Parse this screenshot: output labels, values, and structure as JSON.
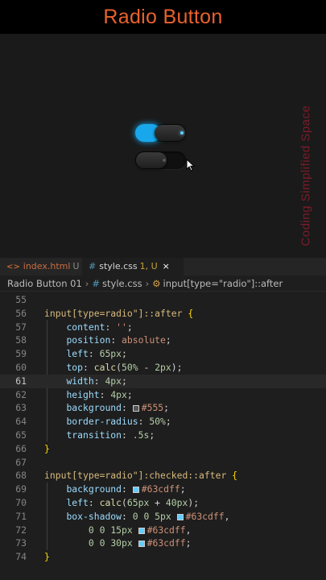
{
  "video_title": "Radio Button",
  "watermark": "Coding Simplified Space",
  "preview": {
    "toggles": [
      {
        "checked": true,
        "accent": "#19a7ec"
      },
      {
        "checked": false,
        "accent": "#555555"
      }
    ]
  },
  "tabs": [
    {
      "icon": "<>",
      "name": "index.html",
      "status": "U"
    },
    {
      "icon": "#",
      "name": "style.css",
      "status": "1, U",
      "close": "×"
    }
  ],
  "breadcrumb": [
    "Radio Button 01",
    "style.css",
    "input[type=\"radio\"]::after"
  ],
  "editor": {
    "active_line": 61,
    "lines": [
      {
        "n": "55",
        "t": ""
      },
      {
        "n": "56",
        "t": "input[type=\"radio\"]::after {"
      },
      {
        "n": "57",
        "t": "    content: '';"
      },
      {
        "n": "58",
        "t": "    position: absolute;"
      },
      {
        "n": "59",
        "t": "    left: 65px;"
      },
      {
        "n": "60",
        "t": "    top: calc(50% - 2px);"
      },
      {
        "n": "61",
        "t": "    width: 4px;"
      },
      {
        "n": "62",
        "t": "    height: 4px;"
      },
      {
        "n": "63",
        "t": "    background: #555;"
      },
      {
        "n": "64",
        "t": "    border-radius: 50%;"
      },
      {
        "n": "65",
        "t": "    transition: .5s;"
      },
      {
        "n": "66",
        "t": "}"
      },
      {
        "n": "67",
        "t": ""
      },
      {
        "n": "68",
        "t": "input[type=\"radio\"]:checked::after {"
      },
      {
        "n": "69",
        "t": "    background: #63cdff;"
      },
      {
        "n": "70",
        "t": "    left: calc(65px + 40px);"
      },
      {
        "n": "71",
        "t": "    box-shadow: 0 0 5px #63cdff,"
      },
      {
        "n": "72",
        "t": "        0 0 15px #63cdff,"
      },
      {
        "n": "73",
        "t": "        0 0 30px #63cdff;"
      },
      {
        "n": "74",
        "t": "}"
      }
    ]
  },
  "colors": {
    "title": "#e8622c",
    "accent": "#63cdff",
    "swatch_gray": "#555555"
  }
}
